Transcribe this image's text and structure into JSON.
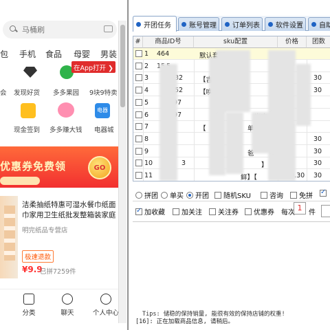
{
  "phone": {
    "search_placeholder": "马桶刷",
    "categories": [
      "包",
      "手机",
      "食品",
      "母婴",
      "男装"
    ],
    "shortcuts_row1": [
      "会",
      "发现好货",
      "多多果园",
      "9块9特卖"
    ],
    "shortcuts_row2": [
      "现金签到",
      "多多赚大钱",
      "电器城"
    ],
    "app_open_label": "在App打开 ❯",
    "banner_text": "优惠券免费领",
    "banner_go": "GO",
    "product": {
      "title": "洁柔抽纸特惠可湿水餐巾纸面巾家用卫生纸批发整箱装家庭",
      "shop": "明完纸品专营店",
      "tag": "极速退款",
      "price": "¥9.9",
      "sold": "已拼7259件"
    },
    "bottom_nav": [
      "分类",
      "聊天",
      "个人中心"
    ]
  },
  "app": {
    "tabs": [
      "开团任务",
      "账号管理",
      "订单列表",
      "软件设置",
      "自助"
    ],
    "table": {
      "headers": [
        "#",
        "商品ID号",
        "sku配置",
        "价格",
        "团数"
      ],
      "rows": [
        {
          "n": "1",
          "id": "464",
          "sku": "默认套餐",
          "price": "",
          "team": ""
        },
        {
          "n": "2",
          "id": "15",
          "sku": "",
          "price": "",
          "team": ""
        },
        {
          "n": "3",
          "id": "",
          "sku": "【吉",
          "price": "",
          "team": "30"
        },
        {
          "n": "4",
          "id": "",
          "sku": "【唤",
          "price": "",
          "team": "30"
        },
        {
          "n": "5",
          "id": "",
          "sku": "",
          "price": "",
          "team": ""
        },
        {
          "n": "6",
          "id": "",
          "sku": "",
          "price": "",
          "team": ""
        },
        {
          "n": "7",
          "id": "",
          "sku": "【",
          "price": "",
          "team": ""
        },
        {
          "n": "8",
          "id": "",
          "sku": "",
          "price": "",
          "team": "30"
        },
        {
          "n": "9",
          "id": "",
          "sku": "",
          "price": "",
          "team": "30"
        },
        {
          "n": "10",
          "id": "",
          "sku": "",
          "price": "",
          "team": "30"
        },
        {
          "n": "11",
          "id": "",
          "sku": "",
          "price": "30.30",
          "team": "30"
        }
      ],
      "fragments": {
        "r2_id_tail": "5",
        "r3_id_tail": "32",
        "r4_id_tail": "52",
        "r5_id_tail": "97",
        "r6_id_tail": "97",
        "r6_sku_tail": "米床",
        "r7_sku_tail": "单杯】",
        "r8_sku_tail": "】",
        "r9_sku_tail": "爸",
        "r10_id_tail": "3",
        "r10_sku_tail": "】",
        "r11_sku_tail": "鲜】【"
      }
    },
    "options": {
      "mode_radios": [
        "拼团",
        "单买",
        "开团"
      ],
      "mode_selected": "开团",
      "checks_row1": [
        "随机SKU",
        "咨询",
        "免拼"
      ],
      "checks_row2": [
        "加收藏",
        "加关注",
        "关注券",
        "优惠券"
      ],
      "per_time_label": "每次:",
      "per_time_value": "1",
      "per_time_unit": "件"
    },
    "log": {
      "tips": "Tips: 储稳的保持销量, 能很有效的保持店铺的权重!",
      "line": "[16]: 正在加载商品信息, 请稍后。"
    }
  }
}
